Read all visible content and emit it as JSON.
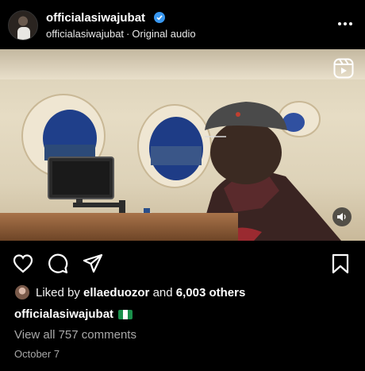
{
  "header": {
    "username": "officialasiwajubat",
    "verified": true,
    "audio_owner": "officialasiwajubat",
    "separator": "·",
    "audio_label": "Original audio",
    "more_icon": "more-horizontal-icon"
  },
  "media": {
    "type": "reel-video",
    "reels_icon": "reels-icon",
    "sound_icon": "speaker-icon"
  },
  "actions": {
    "icons": [
      "heart-icon",
      "comment-icon",
      "share-icon",
      "bookmark-icon"
    ]
  },
  "likes": {
    "prefix": "Liked by ",
    "user": "ellaeduozor",
    "middle": " and ",
    "count": "6,003 others"
  },
  "caption": {
    "username": "officialasiwajubat",
    "emoji": "nigeria-flag"
  },
  "comments": {
    "label": "View all 757 comments"
  },
  "date": "October 7",
  "colors": {
    "background": "#000000",
    "verified": "#3897f0",
    "muted_text": "#a8a8a8"
  }
}
